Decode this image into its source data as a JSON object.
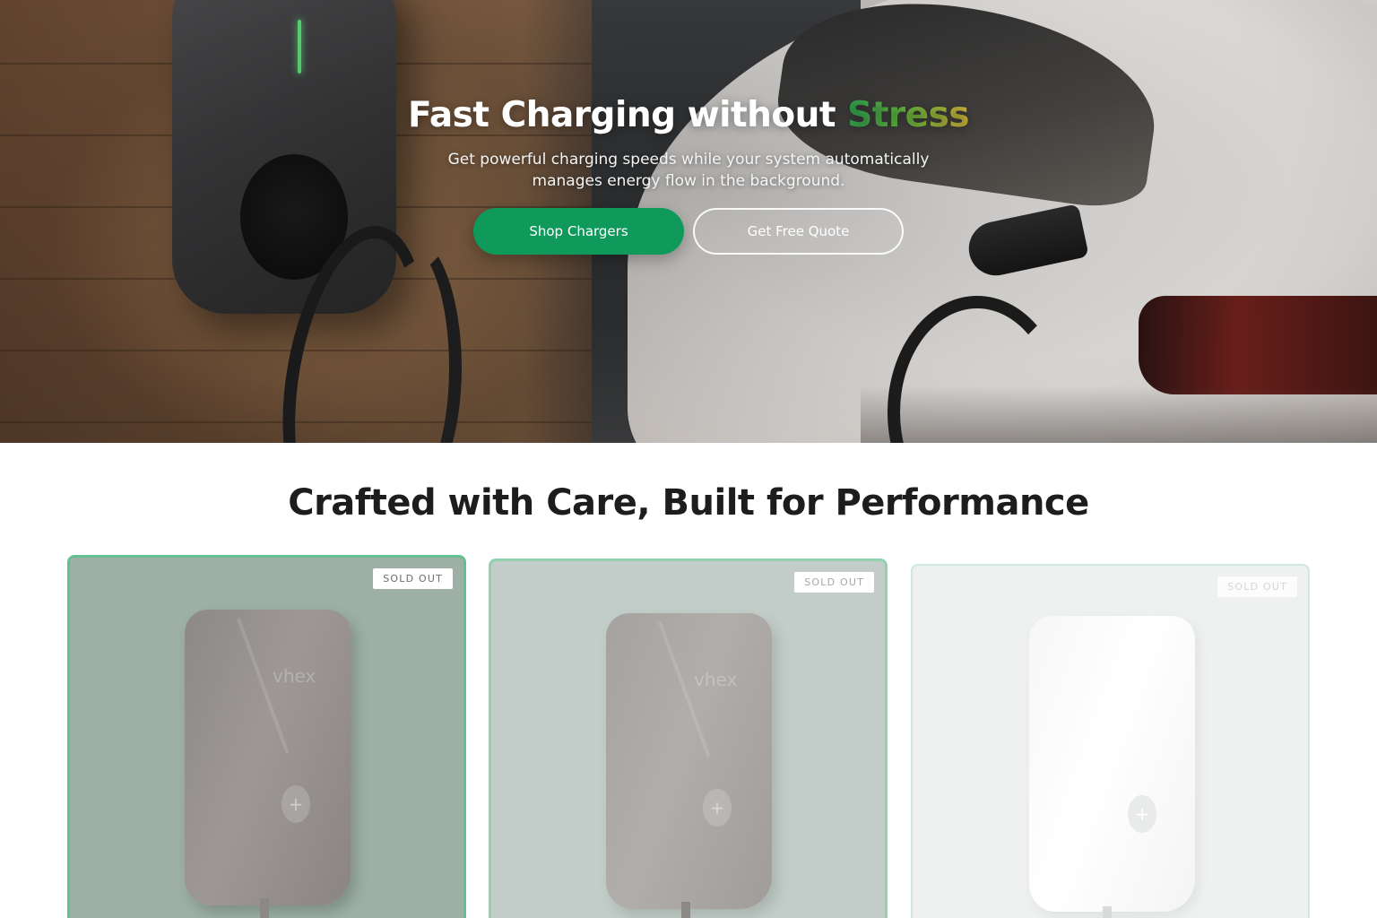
{
  "hero": {
    "title_main": "Fast Charging without ",
    "title_accent": "Stress",
    "subtitle": "Get powerful charging speeds while your system automatically manages energy flow in the background.",
    "primary_button": "Shop Chargers",
    "secondary_button": "Get Free Quote"
  },
  "products": {
    "section_title": "Crafted with Care, Built for Performance",
    "cards": [
      {
        "badge": "SOLD OUT",
        "logo": "vhex"
      },
      {
        "badge": "SOLD OUT",
        "logo": "vhex"
      },
      {
        "badge": "SOLD OUT",
        "logo": ""
      }
    ]
  },
  "colors": {
    "primary": "#0f9a5c",
    "accent_gradient_start": "#2fa84f",
    "accent_gradient_end": "#d6b73a",
    "card_border": "#63c18f"
  }
}
